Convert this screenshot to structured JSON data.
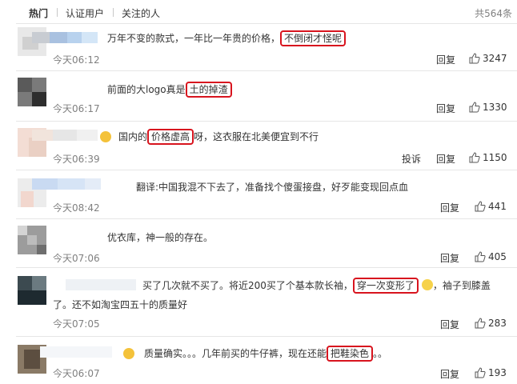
{
  "tabs": [
    {
      "label": "热门"
    },
    {
      "label": "认证用户"
    },
    {
      "label": "关注的人"
    }
  ],
  "total_count": "共564条",
  "comments": [
    {
      "text_before": "万年不变的款式，一年比一年贵的价格，",
      "highlight": "不倒闭才怪呢",
      "text_after": "",
      "time": "今天06:12",
      "reply": "回复",
      "likes": "3247"
    },
    {
      "text_before": "前面的大logo真是",
      "highlight": "土的掉渣",
      "text_after": "",
      "time": "今天06:17",
      "reply": "回复",
      "likes": "1330"
    },
    {
      "text_before": "国内的",
      "highlight": "价格虚高",
      "text_after": "呀，这衣服在北美便宜到不行",
      "time": "今天06:39",
      "report": "投诉",
      "reply": "回复",
      "likes": "1150"
    },
    {
      "text_before": "翻译:中国我混不下去了，准备找个傻蛋接盘，好歹能变现回点血",
      "highlight": "",
      "text_after": "",
      "time": "今天08:42",
      "reply": "回复",
      "likes": "441"
    },
    {
      "text_before": "优衣库，神一般的存在。",
      "highlight": "",
      "text_after": "",
      "time": "今天07:06",
      "reply": "回复",
      "likes": "405"
    },
    {
      "text_before": "买了几次就不买了。将近200买了个基本款长袖，",
      "highlight": "穿一次变形了",
      "text_after": "，袖子到膝盖",
      "line2": "了。还不如淘宝四五十的质量好",
      "time": "今天07:05",
      "reply": "回复",
      "likes": "283"
    },
    {
      "text_before": "质量确实。。。几年前买的牛仔裤，现在还能",
      "highlight": "把鞋染色",
      "text_after": "。。",
      "time": "今天06:07",
      "reply": "回复",
      "likes": "193"
    }
  ],
  "colors": {
    "highlight_border": "#d8141e",
    "time": "#808080",
    "divider": "#e6e6e6"
  }
}
